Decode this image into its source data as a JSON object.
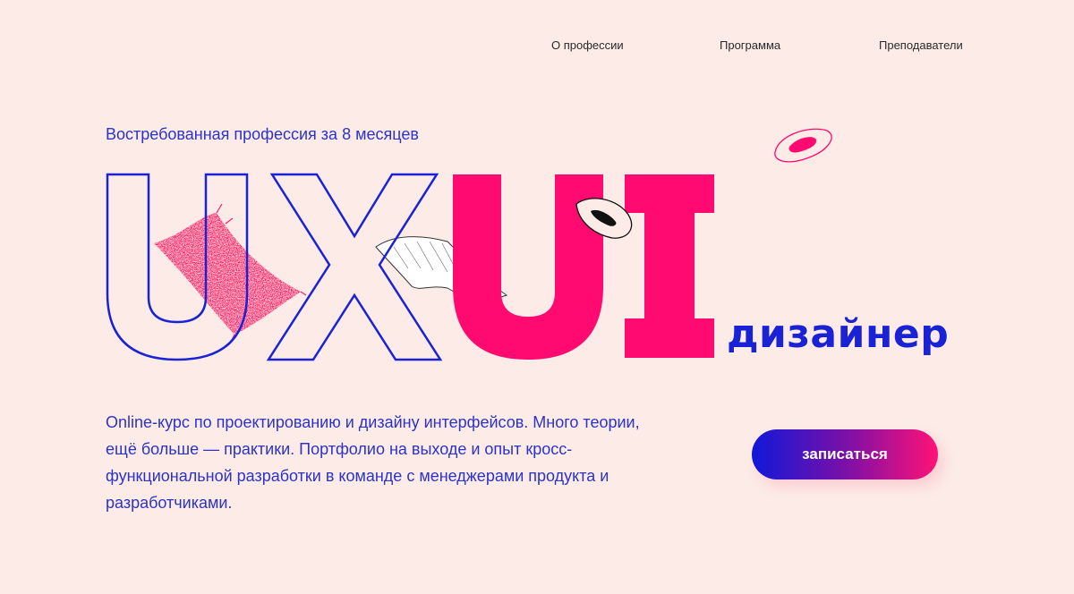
{
  "nav": {
    "items": [
      {
        "label": "О профессии"
      },
      {
        "label": "Программа"
      },
      {
        "label": "Преподаватели"
      }
    ]
  },
  "hero": {
    "tagline": "Востребованная профессия за 8 месяцев",
    "title_outline": "UX",
    "title_solid": "UI",
    "subtitle": "дизайнер",
    "description": "Online-курс по проектированию и дизайну интерфейсов. Много теории, ещё больше — практики. Портфолио на выходе и опыт кросс-функциональной разработки в команде с менеджерами продукта и разработчиками.",
    "cta_label": "записаться"
  },
  "colors": {
    "background": "#fcebe6",
    "blue": "#1a22d6",
    "pink": "#ff0a70",
    "text": "#2b34c8"
  }
}
